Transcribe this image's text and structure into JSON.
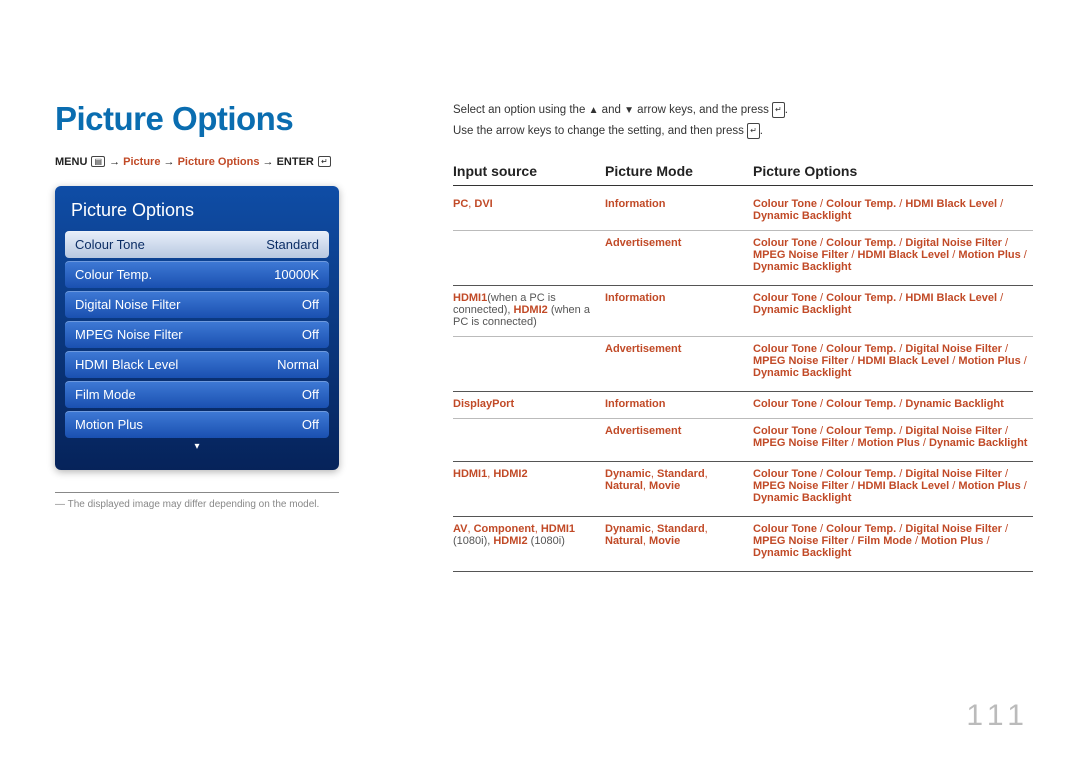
{
  "title": "Picture Options",
  "nav": {
    "menu": "MENU",
    "arrow": "→",
    "path1": "Picture",
    "path2": "Picture Options",
    "enter": "ENTER"
  },
  "osd": {
    "heading": "Picture Options",
    "rows": [
      {
        "label": "Colour Tone",
        "value": "Standard",
        "highlight": true
      },
      {
        "label": "Colour Temp.",
        "value": "10000K"
      },
      {
        "label": "Digital Noise Filter",
        "value": "Off"
      },
      {
        "label": "MPEG Noise Filter",
        "value": "Off"
      },
      {
        "label": "HDMI Black Level",
        "value": "Normal"
      },
      {
        "label": "Film Mode",
        "value": "Off"
      },
      {
        "label": "Motion Plus",
        "value": "Off"
      }
    ]
  },
  "note": "The displayed image may differ depending on the model.",
  "instructions": {
    "line1a": "Select an option using the",
    "line1b": "and",
    "line1c": "arrow keys, and the press",
    "line2a": "Use the arrow keys to change the setting, and then press",
    "dot": "."
  },
  "table": {
    "headers": {
      "c1": "Input source",
      "c2": "Picture Mode",
      "c3": "Picture Options"
    },
    "groups": [
      {
        "c1": [
          {
            "t": "PC",
            "a": true
          },
          {
            "t": ", ",
            "sep": true
          },
          {
            "t": "DVI",
            "a": true
          }
        ],
        "rows": [
          {
            "c2": [
              {
                "t": "Information",
                "a": true
              }
            ],
            "c3": [
              {
                "t": "Colour Tone",
                "a": true
              },
              {
                "t": " / ",
                "sep": true
              },
              {
                "t": "Colour Temp.",
                "a": true
              },
              {
                "t": " / ",
                "sep": true
              },
              {
                "t": "HDMI Black Level",
                "a": true
              },
              {
                "t": " / ",
                "sep": true
              },
              {
                "t": "Dynamic Backlight",
                "a": true
              }
            ]
          },
          {
            "c2": [
              {
                "t": "Advertisement",
                "a": true
              }
            ],
            "c3": [
              {
                "t": "Colour Tone",
                "a": true
              },
              {
                "t": " / ",
                "sep": true
              },
              {
                "t": "Colour Temp.",
                "a": true
              },
              {
                "t": " / ",
                "sep": true
              },
              {
                "t": "Digital Noise Filter",
                "a": true
              },
              {
                "t": " / ",
                "sep": true
              },
              {
                "t": "MPEG Noise Filter",
                "a": true
              },
              {
                "t": " / ",
                "sep": true
              },
              {
                "t": "HDMI Black Level",
                "a": true
              },
              {
                "t": " / ",
                "sep": true
              },
              {
                "t": "Motion Plus",
                "a": true
              },
              {
                "t": " / ",
                "sep": true
              },
              {
                "t": "Dynamic Backlight",
                "a": true
              }
            ]
          }
        ]
      },
      {
        "c1": [
          {
            "t": "HDMI1",
            "a": true
          },
          {
            "t": "(when a PC is connected), ",
            "plain": true
          },
          {
            "t": "HDMI2",
            "a": true
          },
          {
            "t": " (when a PC is connected)",
            "plain": true
          }
        ],
        "rows": [
          {
            "c2": [
              {
                "t": "Information",
                "a": true
              }
            ],
            "c3": [
              {
                "t": "Colour Tone",
                "a": true
              },
              {
                "t": " / ",
                "sep": true
              },
              {
                "t": "Colour Temp.",
                "a": true
              },
              {
                "t": " / ",
                "sep": true
              },
              {
                "t": "HDMI Black Level",
                "a": true
              },
              {
                "t": " / ",
                "sep": true
              },
              {
                "t": "Dynamic Backlight",
                "a": true
              }
            ]
          },
          {
            "c2": [
              {
                "t": "Advertisement",
                "a": true
              }
            ],
            "c3": [
              {
                "t": "Colour Tone",
                "a": true
              },
              {
                "t": " / ",
                "sep": true
              },
              {
                "t": "Colour Temp.",
                "a": true
              },
              {
                "t": " / ",
                "sep": true
              },
              {
                "t": "Digital Noise Filter",
                "a": true
              },
              {
                "t": " / ",
                "sep": true
              },
              {
                "t": "MPEG Noise Filter",
                "a": true
              },
              {
                "t": " / ",
                "sep": true
              },
              {
                "t": "HDMI Black Level",
                "a": true
              },
              {
                "t": " / ",
                "sep": true
              },
              {
                "t": "Motion Plus",
                "a": true
              },
              {
                "t": " / ",
                "sep": true
              },
              {
                "t": "Dynamic Backlight",
                "a": true
              }
            ]
          }
        ]
      },
      {
        "c1": [
          {
            "t": "DisplayPort",
            "a": true
          }
        ],
        "rows": [
          {
            "c2": [
              {
                "t": "Information",
                "a": true
              }
            ],
            "c3": [
              {
                "t": "Colour Tone",
                "a": true
              },
              {
                "t": " / ",
                "sep": true
              },
              {
                "t": "Colour Temp.",
                "a": true
              },
              {
                "t": " / ",
                "sep": true
              },
              {
                "t": "Dynamic Backlight",
                "a": true
              }
            ]
          },
          {
            "c2": [
              {
                "t": "Advertisement",
                "a": true
              }
            ],
            "c3": [
              {
                "t": "Colour Tone",
                "a": true
              },
              {
                "t": " / ",
                "sep": true
              },
              {
                "t": "Colour Temp.",
                "a": true
              },
              {
                "t": " / ",
                "sep": true
              },
              {
                "t": "Digital Noise Filter",
                "a": true
              },
              {
                "t": " / ",
                "sep": true
              },
              {
                "t": "MPEG Noise Filter",
                "a": true
              },
              {
                "t": " / ",
                "sep": true
              },
              {
                "t": "Motion Plus",
                "a": true
              },
              {
                "t": " / ",
                "sep": true
              },
              {
                "t": "Dynamic Backlight",
                "a": true
              }
            ]
          }
        ]
      },
      {
        "c1": [
          {
            "t": "HDMI1",
            "a": true
          },
          {
            "t": ", ",
            "sep": true
          },
          {
            "t": "HDMI2",
            "a": true
          }
        ],
        "rows": [
          {
            "c2": [
              {
                "t": "Dynamic",
                "a": true
              },
              {
                "t": ", ",
                "sep": true
              },
              {
                "t": "Standard",
                "a": true
              },
              {
                "t": ", ",
                "sep": true
              },
              {
                "t": "Natural",
                "a": true
              },
              {
                "t": ", ",
                "sep": true
              },
              {
                "t": "Movie",
                "a": true
              }
            ],
            "c3": [
              {
                "t": "Colour Tone",
                "a": true
              },
              {
                "t": " / ",
                "sep": true
              },
              {
                "t": "Colour Temp.",
                "a": true
              },
              {
                "t": " / ",
                "sep": true
              },
              {
                "t": "Digital Noise Filter",
                "a": true
              },
              {
                "t": " / ",
                "sep": true
              },
              {
                "t": "MPEG Noise Filter",
                "a": true
              },
              {
                "t": " / ",
                "sep": true
              },
              {
                "t": "HDMI Black Level",
                "a": true
              },
              {
                "t": " / ",
                "sep": true
              },
              {
                "t": "Motion Plus",
                "a": true
              },
              {
                "t": " / ",
                "sep": true
              },
              {
                "t": "Dynamic Backlight",
                "a": true
              }
            ]
          }
        ]
      },
      {
        "c1": [
          {
            "t": "AV",
            "a": true
          },
          {
            "t": ", ",
            "sep": true
          },
          {
            "t": "Component",
            "a": true
          },
          {
            "t": ", ",
            "sep": true
          },
          {
            "t": "HDMI1",
            "a": true
          },
          {
            "t": " (1080i), ",
            "plain": true
          },
          {
            "t": "HDMI2",
            "a": true
          },
          {
            "t": " (1080i)",
            "plain": true
          }
        ],
        "rows": [
          {
            "c2": [
              {
                "t": "Dynamic",
                "a": true
              },
              {
                "t": ", ",
                "sep": true
              },
              {
                "t": "Standard",
                "a": true
              },
              {
                "t": ", ",
                "sep": true
              },
              {
                "t": "Natural",
                "a": true
              },
              {
                "t": ", ",
                "sep": true
              },
              {
                "t": "Movie",
                "a": true
              }
            ],
            "c3": [
              {
                "t": "Colour Tone",
                "a": true
              },
              {
                "t": " / ",
                "sep": true
              },
              {
                "t": "Colour Temp.",
                "a": true
              },
              {
                "t": " / ",
                "sep": true
              },
              {
                "t": "Digital Noise Filter",
                "a": true
              },
              {
                "t": " / ",
                "sep": true
              },
              {
                "t": "MPEG Noise Filter",
                "a": true
              },
              {
                "t": " / ",
                "sep": true
              },
              {
                "t": "Film Mode",
                "a": true
              },
              {
                "t": " / ",
                "sep": true
              },
              {
                "t": "Motion Plus",
                "a": true
              },
              {
                "t": " / ",
                "sep": true
              },
              {
                "t": "Dynamic Backlight",
                "a": true
              }
            ]
          }
        ]
      }
    ]
  },
  "pageNumber": "111"
}
